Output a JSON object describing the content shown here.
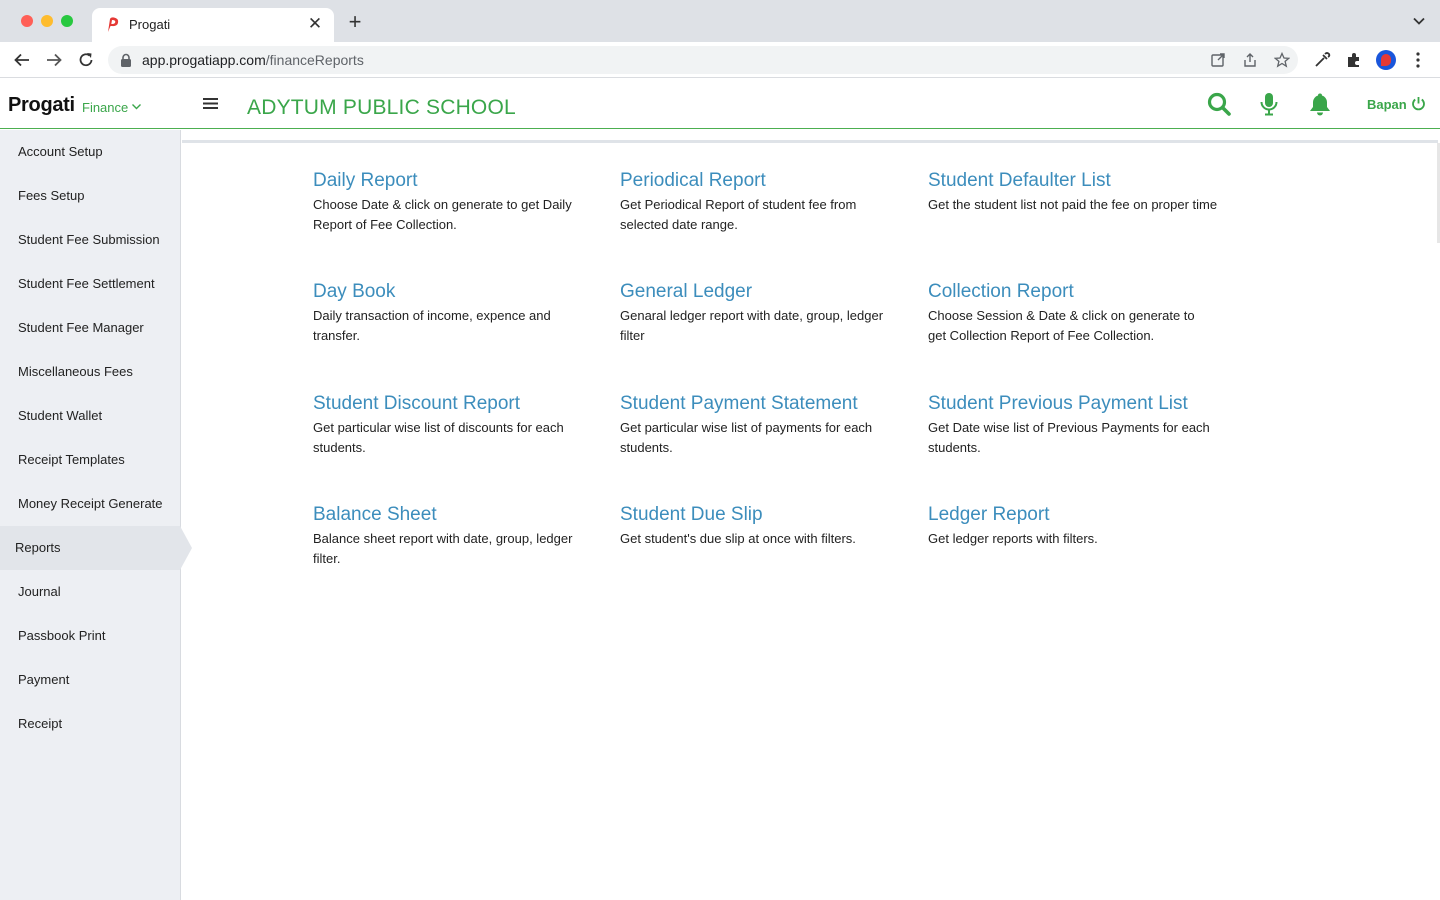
{
  "browser": {
    "tab_title": "Progati",
    "url_host": "app.progatiapp.com",
    "url_path": "/financeReports"
  },
  "header": {
    "brand": "Progati",
    "module": "Finance",
    "school_name": "ADYTUM PUBLIC SCHOOL",
    "user": "Bapan",
    "accent_color": "#3aa64a"
  },
  "sidebar": {
    "items": [
      {
        "label": "Account Setup"
      },
      {
        "label": "Fees Setup"
      },
      {
        "label": "Student Fee Submission"
      },
      {
        "label": "Student Fee Settlement"
      },
      {
        "label": "Student Fee Manager"
      },
      {
        "label": "Miscellaneous Fees"
      },
      {
        "label": "Student Wallet"
      },
      {
        "label": "Receipt Templates"
      },
      {
        "label": "Money Receipt Generate"
      },
      {
        "label": "Reports",
        "active": true
      },
      {
        "label": "Journal"
      },
      {
        "label": "Passbook Print"
      },
      {
        "label": "Payment"
      },
      {
        "label": "Receipt"
      }
    ]
  },
  "reports": [
    {
      "title": "Daily Report",
      "desc": "Choose Date & click on generate to get Daily Report of Fee Collection."
    },
    {
      "title": "Periodical Report",
      "desc": "Get Periodical Report of student fee from selected date range."
    },
    {
      "title": "Student Defaulter List",
      "desc": "Get the student list not paid the fee on proper time"
    },
    {
      "title": "Day Book",
      "desc": "Daily transaction of income, expence and transfer."
    },
    {
      "title": "General Ledger",
      "desc": "Genaral ledger report with date, group, ledger filter"
    },
    {
      "title": "Collection Report",
      "desc": "Choose Session & Date & click on generate to get Collection Report of Fee Collection."
    },
    {
      "title": "Student Discount Report",
      "desc": "Get particular wise list of discounts for each students."
    },
    {
      "title": "Student Payment Statement",
      "desc": "Get particular wise list of payments for each students."
    },
    {
      "title": "Student Previous Payment List",
      "desc": "Get Date wise list of Previous Payments for each students."
    },
    {
      "title": "Balance Sheet",
      "desc": "Balance sheet report with date, group, ledger filter."
    },
    {
      "title": "Student Due Slip",
      "desc": "Get student's due slip at once with filters."
    },
    {
      "title": "Ledger Report",
      "desc": "Get ledger reports with filters."
    }
  ]
}
